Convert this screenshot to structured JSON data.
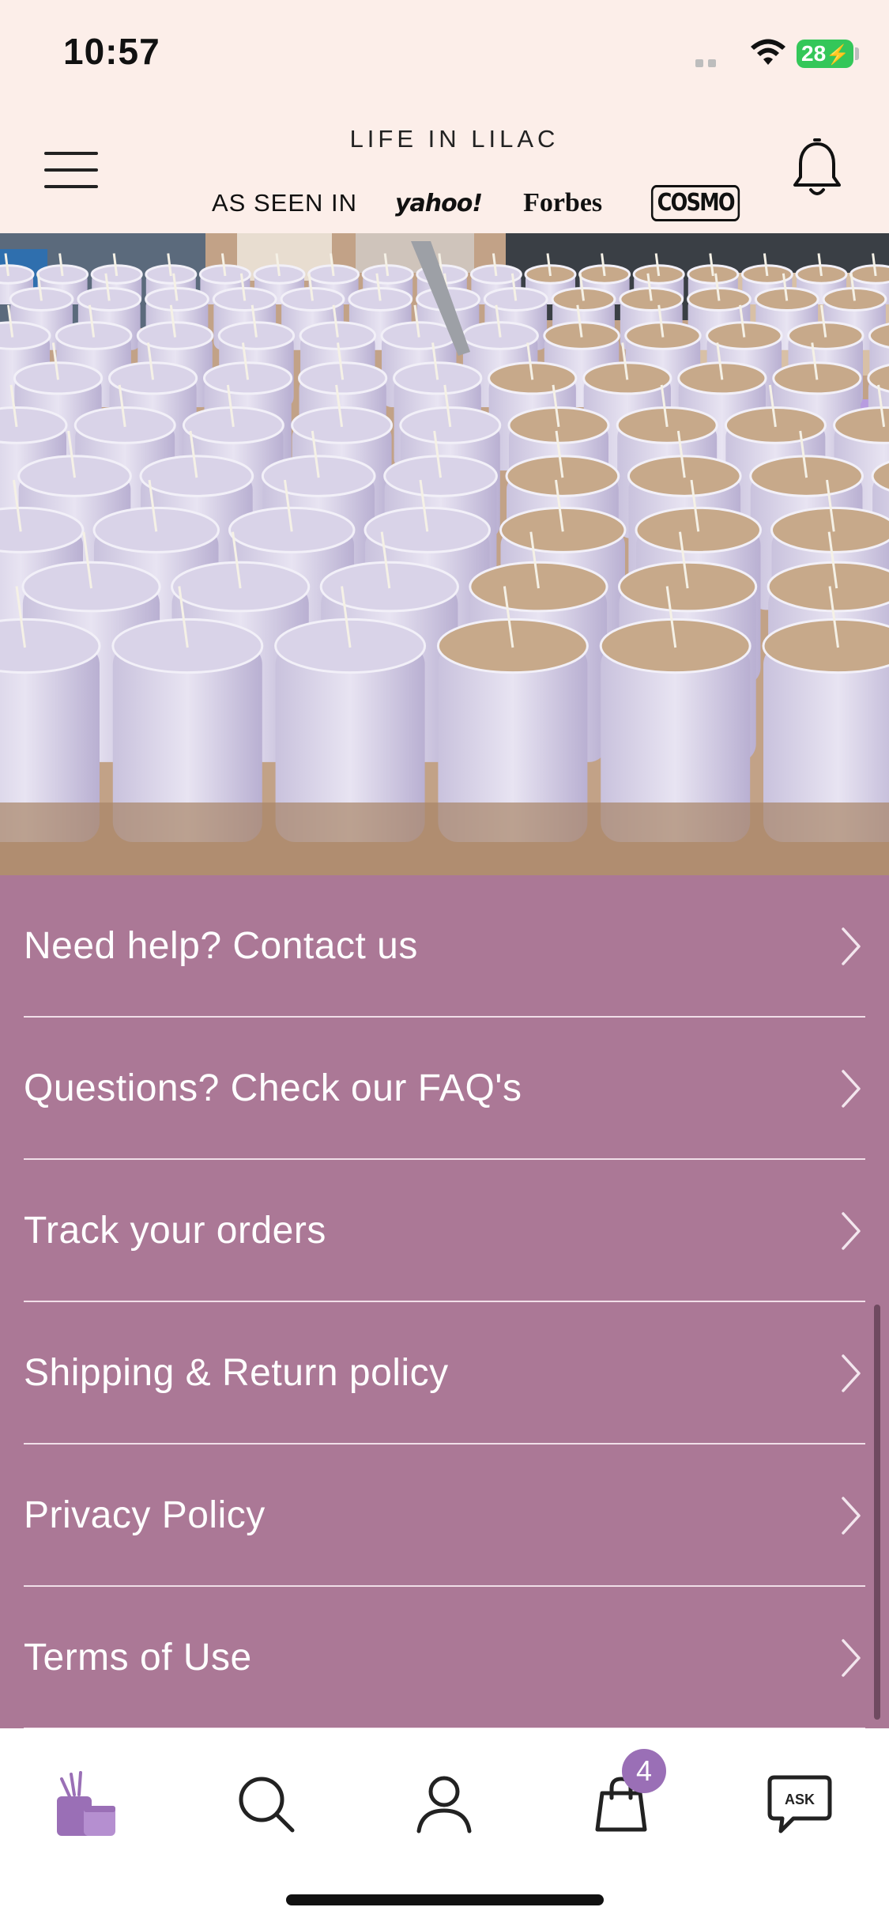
{
  "status_bar": {
    "time": "10:57",
    "battery": "28"
  },
  "header": {
    "brand": "LIFE IN LILAC",
    "seen_in_label": "AS SEEN IN",
    "press_logos": [
      "yahoo!",
      "Forbes",
      "COSMO"
    ],
    "icons": [
      "menu-icon",
      "bell-icon"
    ]
  },
  "hero": {
    "icon": "candle-production-photo"
  },
  "support_menu": {
    "items": [
      {
        "label": "Need help? Contact us"
      },
      {
        "label": "Questions? Check our FAQ's"
      },
      {
        "label": "Track your orders"
      },
      {
        "label": "Shipping & Return policy"
      },
      {
        "label": "Privacy Policy"
      },
      {
        "label": "Terms of Use"
      }
    ]
  },
  "tab_bar": {
    "tabs": [
      "home-candle-icon",
      "search-icon",
      "account-icon",
      "bag-icon",
      "ask-chat-icon"
    ],
    "cart_count": "4",
    "ask_label": "ASK",
    "active_color": "#9a6fb6"
  },
  "colors": {
    "header_bg": "#fceee9",
    "menu_bg": "#ab7896",
    "accent": "#9a6fb6"
  }
}
